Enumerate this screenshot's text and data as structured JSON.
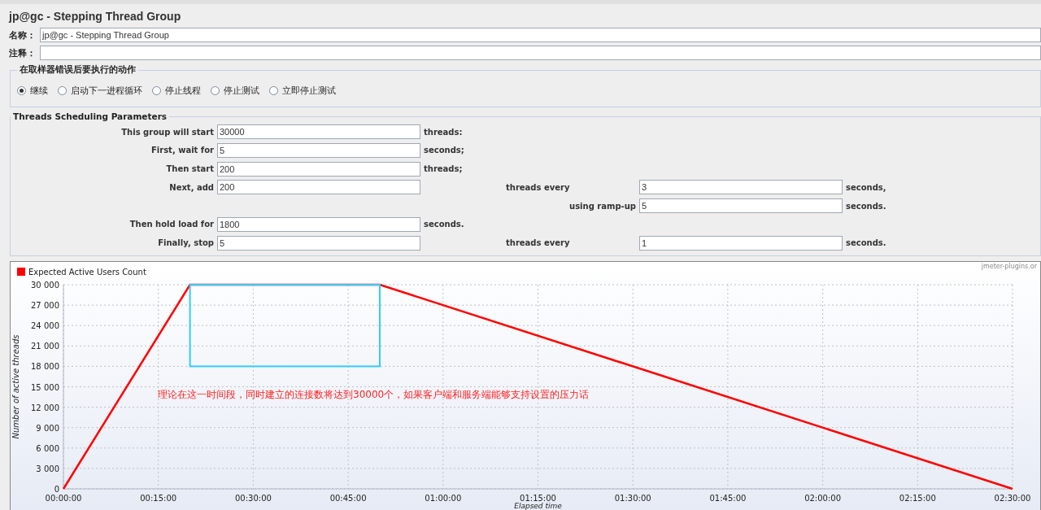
{
  "title": "jp@gc - Stepping Thread Group",
  "name_field": {
    "label": "名称：",
    "value": "jp@gc - Stepping Thread Group"
  },
  "comment_field": {
    "label": "注释："
  },
  "error_action": {
    "legend": "在取样器错误后要执行的动作",
    "options": [
      {
        "label": "继续",
        "selected": true
      },
      {
        "label": "启动下一进程循环",
        "selected": false
      },
      {
        "label": "停止线程",
        "selected": false
      },
      {
        "label": "停止测试",
        "selected": false
      },
      {
        "label": "立即停止测试",
        "selected": false
      }
    ]
  },
  "scheduling": {
    "legend": "Threads Scheduling Parameters",
    "rows": [
      {
        "kind": "main",
        "label": "This group will start",
        "value": "30000",
        "unit": "threads:"
      },
      {
        "kind": "main",
        "label": "First, wait for",
        "value": "5",
        "unit": "seconds;"
      },
      {
        "kind": "main",
        "label": "Then start",
        "value": "200",
        "unit": "threads;"
      },
      {
        "kind": "main",
        "label": "Next, add",
        "value": "200",
        "unit": "",
        "extra": {
          "label": "threads every",
          "value": "3",
          "unit": "seconds,"
        }
      },
      {
        "kind": "continuation",
        "label": "using ramp-up",
        "value": "5",
        "unit": "seconds."
      },
      {
        "kind": "main",
        "label": "Then hold load for",
        "value": "1800",
        "unit": "seconds."
      },
      {
        "kind": "main",
        "label": "Finally, stop",
        "value": "5",
        "unit": "",
        "extra": {
          "label": "threads every",
          "value": "1",
          "unit": "seconds."
        }
      }
    ]
  },
  "chart": {
    "credit": "jmeter-plugins.or",
    "chart_data": {
      "type": "line",
      "grid": true,
      "xlabel": "Elapsed time",
      "ylabel": "Number of active threads",
      "xlim": [
        0,
        150
      ],
      "ylim": [
        0,
        30000
      ],
      "series": [
        {
          "name": "Expected Active Users Count",
          "color": "#ff0000",
          "x": [
            0,
            20,
            50,
            150
          ],
          "values": [
            0,
            30000,
            30000,
            0
          ]
        }
      ],
      "xticks": [
        {
          "value": 0,
          "label": "00:00:00"
        },
        {
          "value": 15,
          "label": "00:15:00"
        },
        {
          "value": 30,
          "label": "00:30:00"
        },
        {
          "value": 45,
          "label": "00:45:00"
        },
        {
          "value": 60,
          "label": "01:00:00"
        },
        {
          "value": 75,
          "label": "01:15:00"
        },
        {
          "value": 90,
          "label": "01:30:00"
        },
        {
          "value": 105,
          "label": "01:45:00"
        },
        {
          "value": 120,
          "label": "02:00:00"
        },
        {
          "value": 135,
          "label": "02:15:00"
        },
        {
          "value": 150,
          "label": "02:30:00"
        }
      ],
      "yticks": [
        {
          "value": 0,
          "label": "0"
        },
        {
          "value": 3000,
          "label": "3 000"
        },
        {
          "value": 6000,
          "label": "6 000"
        },
        {
          "value": 9000,
          "label": "9 000"
        },
        {
          "value": 12000,
          "label": "12 000"
        },
        {
          "value": 15000,
          "label": "15 000"
        },
        {
          "value": 18000,
          "label": "18 000"
        },
        {
          "value": 21000,
          "label": "21 000"
        },
        {
          "value": 24000,
          "label": "24 000"
        },
        {
          "value": 27000,
          "label": "27 000"
        },
        {
          "value": 30000,
          "label": "30 000"
        }
      ],
      "annotations": [
        "理论在这一时间段，同时建立的连接数将达到30000个，如果客户端和服务端能够支持设置的压力话"
      ]
    }
  }
}
